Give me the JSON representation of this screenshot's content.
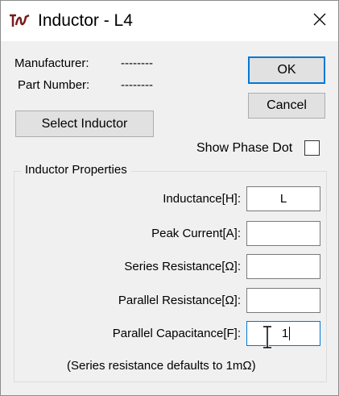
{
  "window": {
    "title": "Inductor - L4",
    "icons": {
      "app": "inductor-app-icon",
      "close": "close-icon",
      "cursor": "ibeam-cursor-icon"
    }
  },
  "info": {
    "manufacturer_label": "Manufacturer:",
    "manufacturer_value": "--------",
    "part_number_label": "Part Number:",
    "part_number_value": "--------"
  },
  "buttons": {
    "ok": "OK",
    "cancel": "Cancel",
    "select_inductor": "Select Inductor"
  },
  "show_phase_dot": {
    "label": "Show Phase Dot",
    "checked": false
  },
  "properties": {
    "title": "Inductor Properties",
    "fields": [
      {
        "label": "Inductance[H]:",
        "value": "L"
      },
      {
        "label": "Peak Current[A]:",
        "value": ""
      },
      {
        "label": "Series Resistance[Ω]:",
        "value": ""
      },
      {
        "label": "Parallel Resistance[Ω]:",
        "value": ""
      },
      {
        "label": "Parallel Capacitance[F]:",
        "value": "1"
      }
    ],
    "note": "(Series resistance defaults to 1mΩ)"
  },
  "colors": {
    "focus": "#0078d7",
    "window_bg": "#f0f0f0",
    "button_bg": "#e1e1e1"
  }
}
